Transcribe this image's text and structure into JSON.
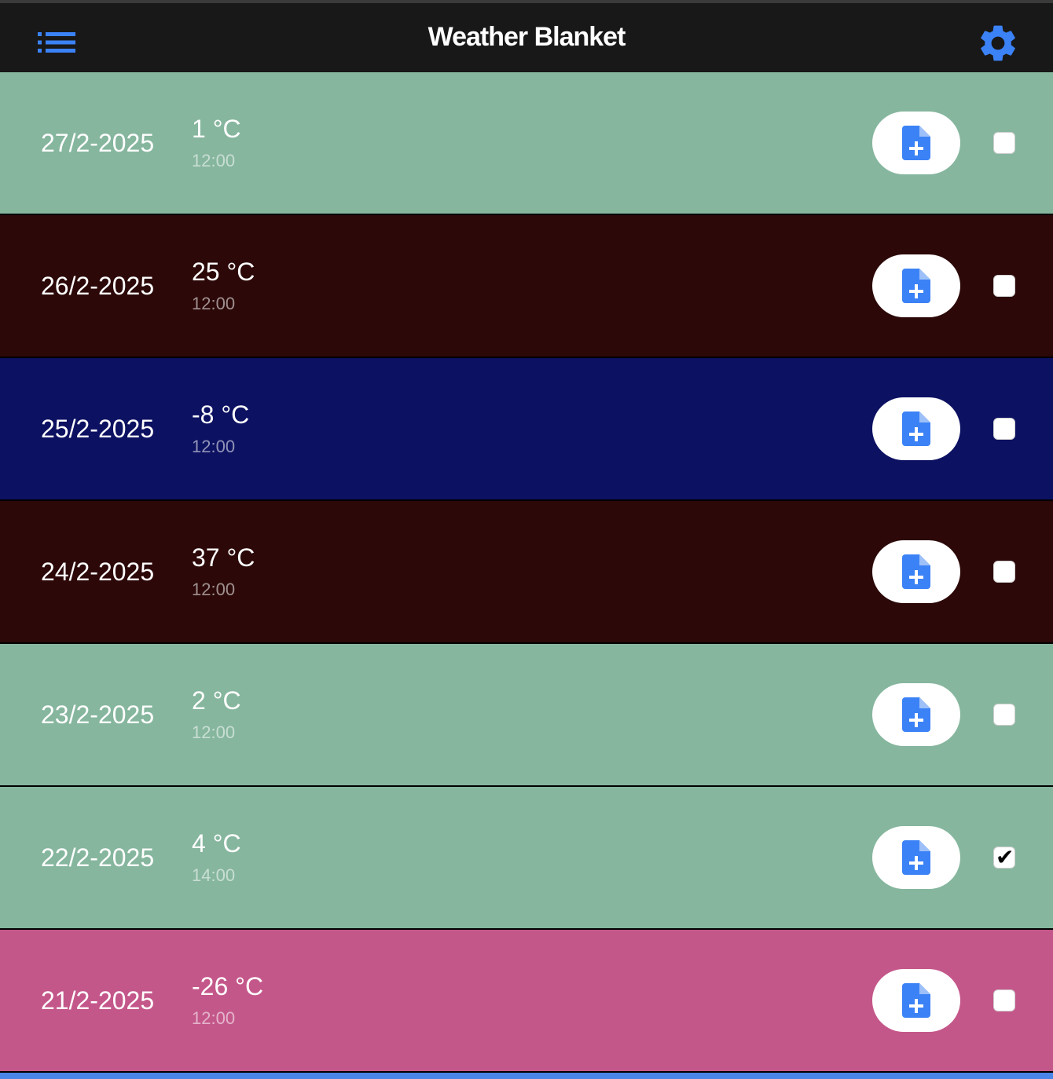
{
  "app": {
    "title": "Weather Blanket",
    "accent": "#3b82f6",
    "menu_icon": "list-icon",
    "settings_icon": "gear-icon"
  },
  "entries": [
    {
      "date": "27/2-2025",
      "temp": "1 °C",
      "time": "12:00",
      "color": "#86b69e",
      "checked": false
    },
    {
      "date": "26/2-2025",
      "temp": "25 °C",
      "time": "12:00",
      "color": "#2c0808",
      "checked": false
    },
    {
      "date": "25/2-2025",
      "temp": "-8 °C",
      "time": "12:00",
      "color": "#0c1161",
      "checked": false
    },
    {
      "date": "24/2-2025",
      "temp": "37 °C",
      "time": "12:00",
      "color": "#2c0808",
      "checked": false
    },
    {
      "date": "23/2-2025",
      "temp": "2 °C",
      "time": "12:00",
      "color": "#86b69e",
      "checked": false
    },
    {
      "date": "22/2-2025",
      "temp": "4 °C",
      "time": "14:00",
      "color": "#86b69e",
      "checked": true
    },
    {
      "date": "21/2-2025",
      "temp": "-26 °C",
      "time": "12:00",
      "color": "#c4578a",
      "checked": false
    }
  ]
}
